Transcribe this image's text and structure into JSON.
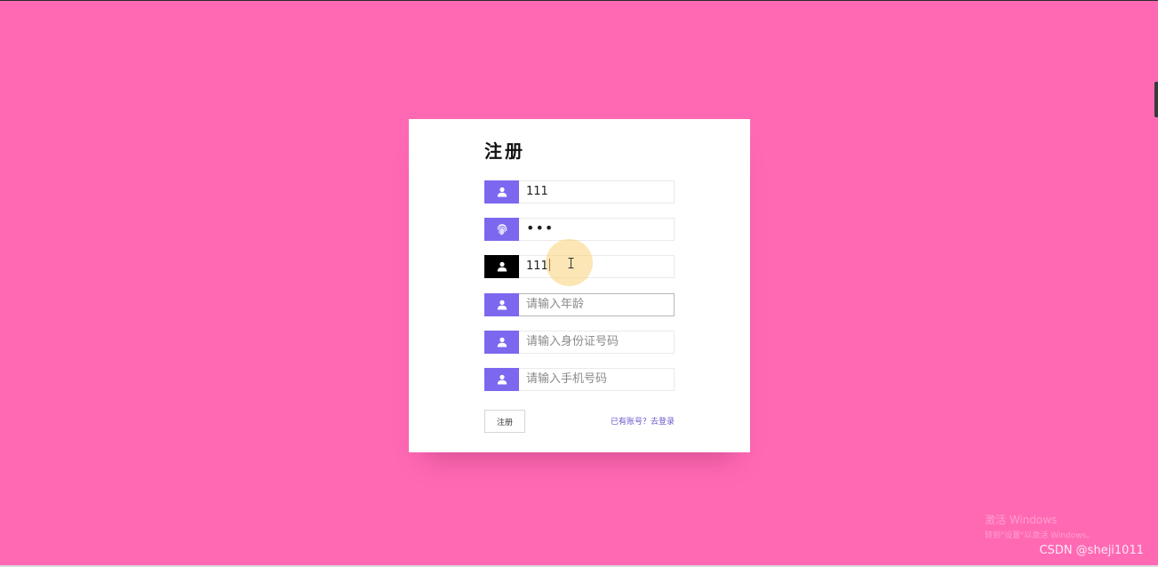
{
  "colors": {
    "background": "#ff69b4",
    "card": "#ffffff",
    "icon_accent": "#7b68ee",
    "icon_active": "#000000",
    "link": "#6a5acd"
  },
  "form": {
    "title": "注册",
    "fields": [
      {
        "icon": "user-icon",
        "value": "111",
        "placeholder": ""
      },
      {
        "icon": "fingerprint-icon",
        "value": "•••",
        "placeholder": ""
      },
      {
        "icon": "user-icon",
        "value": "111",
        "placeholder": ""
      },
      {
        "icon": "user-icon",
        "value": "",
        "placeholder": "请输入年龄"
      },
      {
        "icon": "user-icon",
        "value": "",
        "placeholder": "请输入身份证号码"
      },
      {
        "icon": "user-icon",
        "value": "",
        "placeholder": "请输入手机号码"
      }
    ],
    "submit_label": "注册",
    "login_link": "已有账号？去登录"
  },
  "watermarks": {
    "windows_line1": "激活 Windows",
    "windows_line2": "转到\"设置\"以激活 Windows。",
    "csdn": "CSDN @sheji1011"
  }
}
